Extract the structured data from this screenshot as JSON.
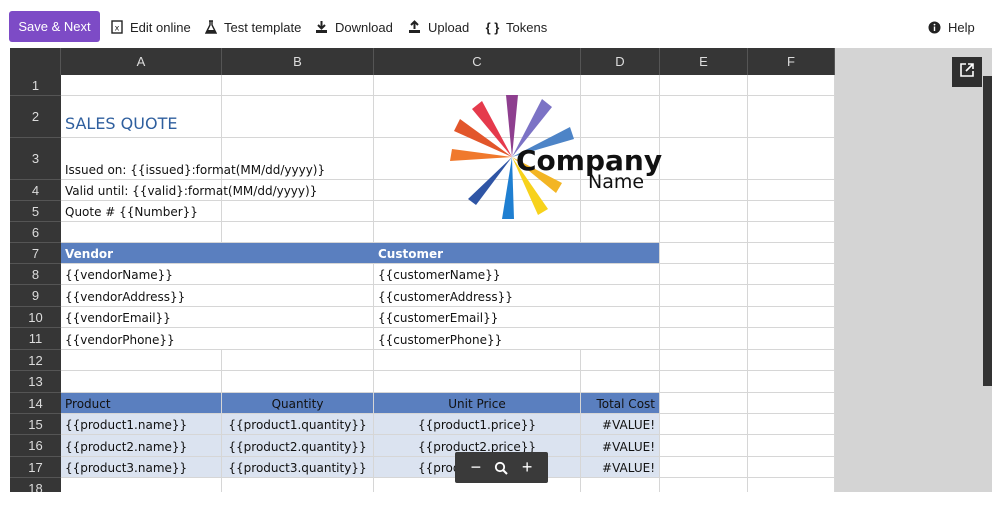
{
  "toolbar": {
    "save_next": "Save & Next",
    "edit_online": "Edit online",
    "test_template": "Test template",
    "download": "Download",
    "upload": "Upload",
    "tokens": "Tokens",
    "help": "Help"
  },
  "columns": [
    "A",
    "B",
    "C",
    "D",
    "E",
    "F"
  ],
  "rows": [
    "1",
    "2",
    "3",
    "4",
    "5",
    "6",
    "7",
    "8",
    "9",
    "10",
    "11",
    "12",
    "13",
    "14",
    "15",
    "16",
    "17",
    "18"
  ],
  "sheet": {
    "title": "SALES QUOTE",
    "issued": "Issued on: {{issued}:format(MM/dd/yyyy)}",
    "valid": "Valid until: {{valid}:format(MM/dd/yyyy)}",
    "quote": "Quote # {{Number}}",
    "vendor_header": "Vendor",
    "customer_header": "Customer",
    "vendor": [
      "{{vendorName}}",
      "{{vendorAddress}}",
      "{{vendorEmail}}",
      "{{vendorPhone}}"
    ],
    "customer": [
      "{{customerName}}",
      "{{customerAddress}}",
      "{{customerEmail}}",
      "{{customerPhone}}"
    ],
    "product_headers": [
      "Product",
      "Quantity",
      "Unit Price",
      "Total Cost"
    ],
    "products": [
      [
        "{{product1.name}}",
        "{{product1.quantity}}",
        "{{product1.price}}",
        "#VALUE!"
      ],
      [
        "{{product2.name}}",
        "{{product2.quantity}}",
        "{{product2.price}}",
        "#VALUE!"
      ],
      [
        "{{product3.name}}",
        "{{product3.quantity}}",
        "{{product3.price}}",
        "#VALUE!"
      ]
    ]
  },
  "logo": {
    "line1": "Company",
    "line2": "Name"
  },
  "zoom": {
    "minus": "−",
    "plus": "+"
  },
  "colors": {
    "accent": "#7d4bc6",
    "header_blue": "#5a7fbf",
    "row_blue": "#dbe3f0",
    "grid_header": "#363636"
  }
}
